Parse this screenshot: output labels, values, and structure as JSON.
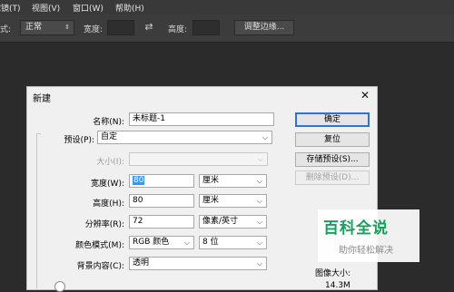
{
  "menubar": {
    "items": [
      "滤镜(T)",
      "视图(V)",
      "窗口(W)",
      "帮助(H)"
    ]
  },
  "options_bar": {
    "style_label": "式:",
    "style_value": "正常",
    "width_label": "宽度:",
    "height_label": "高度:",
    "adjust_edge_button": "调整边缘..."
  },
  "dialog": {
    "title": "新建",
    "name_label": "名称(N):",
    "name_value": "未标题-1",
    "preset_label": "预设(P):",
    "preset_value": "自定",
    "size_label": "大小(I):",
    "width_label": "宽度(W):",
    "width_value": "80",
    "width_unit": "厘米",
    "height_label": "高度(H):",
    "height_value": "80",
    "height_unit": "厘米",
    "resolution_label": "分辨率(R):",
    "resolution_value": "72",
    "resolution_unit": "像素/英寸",
    "color_mode_label": "颜色模式(M):",
    "color_mode_value": "RGB 颜色",
    "bit_depth_value": "8 位",
    "background_label": "背景内容(C):",
    "background_value": "透明",
    "buttons": {
      "ok": "确定",
      "reset": "复位",
      "save_preset": "存储预设(S)...",
      "delete_preset": "删除预设(D)..."
    },
    "image_size_label": "图像大小:",
    "image_size_value": "14.3M"
  },
  "watermark": {
    "title": "百科全说",
    "subtitle": "助你轻松解决"
  }
}
